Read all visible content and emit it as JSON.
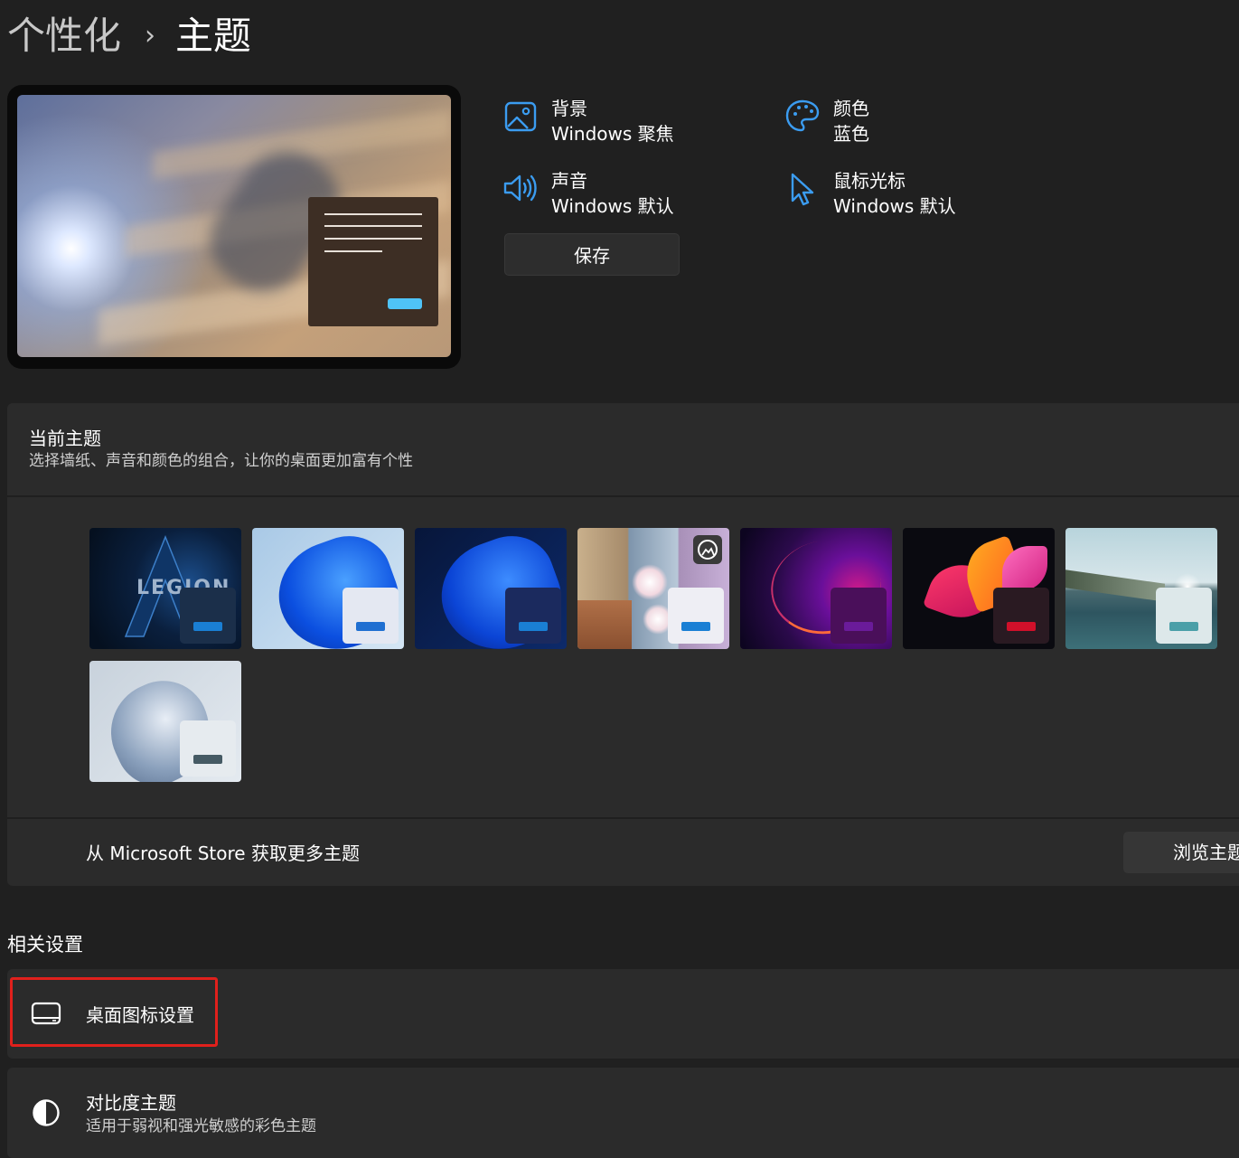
{
  "breadcrumb": {
    "parent": "个性化",
    "separator": "›",
    "current": "主题"
  },
  "info": {
    "background": {
      "label": "背景",
      "value": "Windows 聚焦"
    },
    "color": {
      "label": "颜色",
      "value": "蓝色"
    },
    "sound": {
      "label": "声音",
      "value": "Windows 默认"
    },
    "cursor": {
      "label": "鼠标光标",
      "value": "Windows 默认"
    },
    "save_label": "保存"
  },
  "current_theme": {
    "title": "当前主题",
    "subtitle": "选择墙纸、声音和颜色的组合，让你的桌面更加富有个性",
    "themes": [
      {
        "name": "legion",
        "logo_text": "LEGION",
        "accent": "#1a7fd4"
      },
      {
        "name": "windows-light",
        "accent": "#1f6fd1"
      },
      {
        "name": "windows-dark",
        "accent": "#1a7fd4"
      },
      {
        "name": "spotlight-collection",
        "accent": "#1a7fd4"
      },
      {
        "name": "glow",
        "accent": "#6a1b9a"
      },
      {
        "name": "captured-motion",
        "accent": "#d0102a"
      },
      {
        "name": "sunrise",
        "accent": "#4a9fa8"
      },
      {
        "name": "flow",
        "accent": "#455a64"
      }
    ],
    "store_text": "从 Microsoft Store 获取更多主题",
    "browse_label": "浏览主题"
  },
  "related": {
    "title": "相关设置",
    "desktop_icons": {
      "label": "桌面图标设置"
    },
    "contrast": {
      "label": "对比度主题",
      "sub": "适用于弱视和强光敏感的彩色主题"
    }
  },
  "colors": {
    "accent_icon": "#3b9cf0",
    "highlight_box": "#e0201c"
  }
}
